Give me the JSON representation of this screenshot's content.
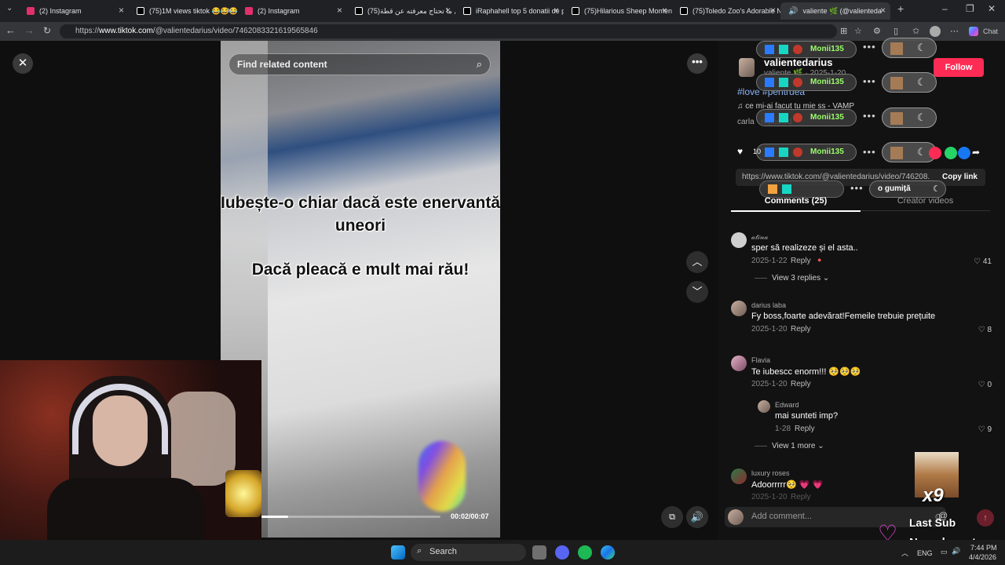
{
  "browser": {
    "tabs": [
      {
        "title": "(2) Instagram",
        "color": "#e1306c"
      },
      {
        "title": "(75)1M views tiktok 😂😂😂😂",
        "color": "#111111"
      },
      {
        "title": "(2) Instagram",
        "color": "#e1306c"
      },
      {
        "title": "(75)كل ما تحتاج معرفته عن قطة",
        "color": "#111111"
      },
      {
        "title": "iRaphahell top 5 donatii de p",
        "color": "#111111"
      },
      {
        "title": "(75)Hilarious Sheep Moment",
        "color": "#111111"
      },
      {
        "title": "(75)Toledo Zoo's Adorable N",
        "color": "#111111"
      },
      {
        "title": "valiente 🌿 (@valienteda",
        "color": "#111111"
      }
    ],
    "url_prefix": "https://",
    "url_host": "www.tiktok.com",
    "url_path": "/@valientedarius/video/7462083321619565846",
    "chat_label": "Chat"
  },
  "video": {
    "search_placeholder": "Find related content",
    "caption_line1": "Iubește-o chiar dacă este enervantă uneori",
    "caption_line2": "Dacă pleacă e mult mai rău!",
    "timecode": "00:02/00:07",
    "progress_fraction": 0.15
  },
  "creator": {
    "name": "valientedarius",
    "subline": "valiente 🌿 · 2025-1-20",
    "follow_label": "Follow",
    "hashtags": "#love #pentruea",
    "music": "♫  ce mi-ai facut tu mie ss - VAMP",
    "repost": "carla · reposted",
    "likes": "10"
  },
  "overlay_notifications": [
    {
      "name": "Monii135"
    },
    {
      "name": "Monii135"
    },
    {
      "name": "Monii135"
    },
    {
      "name": "Monii135"
    }
  ],
  "gumita_label": "o gumiță",
  "copylink": {
    "url": "https://www.tiktok.com/@valientedarius/video/746208...",
    "button": "Copy link"
  },
  "tabs": {
    "comments": "Comments (25)",
    "creator_videos": "Creator videos"
  },
  "comments": [
    {
      "name": "𝒶𝓉𝒾𝓃𝒶",
      "text": "sper să realizeze și el asta..",
      "date": "2025-1-22",
      "reply": "Reply",
      "likes": "41"
    },
    {
      "name": "darius laba",
      "text": "Fy boss,foarte adevărat!Femeile trebuie prețuite",
      "date": "2025-1-20",
      "reply": "Reply",
      "likes": "8"
    },
    {
      "name": "Flavia",
      "text": "Te iubescc enorm!!! 🥺🥺🥺",
      "date": "2025-1-20",
      "reply": "Reply",
      "likes": "0"
    },
    {
      "name": "Edward",
      "text": "mai sunteti imp?",
      "date": "1-28",
      "reply": "Reply",
      "likes": "9"
    },
    {
      "name": "luxury roses",
      "text": "Adoorrrrr🥺 💗 💗",
      "date": "2025-1-20",
      "reply": "Reply",
      "likes": ""
    }
  ],
  "view_replies": [
    "View 3 replies",
    "View 1 more"
  ],
  "add_comment_placeholder": "Add comment...",
  "stream_overlay": {
    "multiplier": "x9",
    "last_sub": "Last Sub",
    "no_subs": "No subs yet"
  },
  "taskbar": {
    "search": "Search",
    "lang": "ENG",
    "time": "7:44 PM",
    "date": "4/4/2026"
  }
}
